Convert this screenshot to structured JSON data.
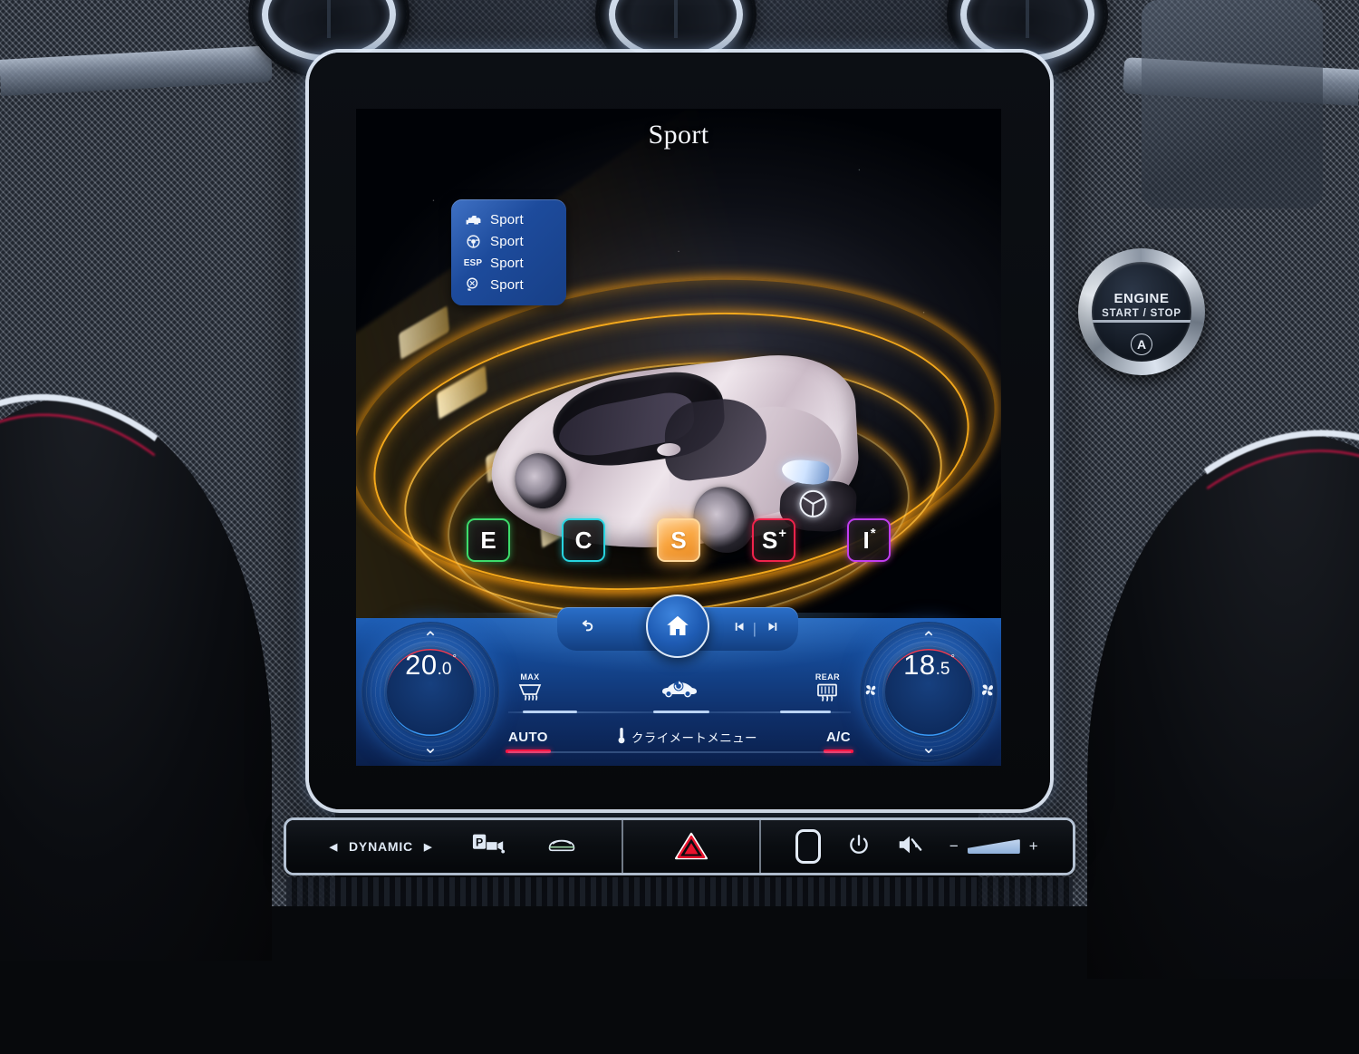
{
  "vehicle_ui": {
    "screen_title": "Sport",
    "mode_list": [
      {
        "icon": "engine-icon",
        "label": "Sport"
      },
      {
        "icon": "steering-wheel-icon",
        "label": "Sport"
      },
      {
        "icon": "esp-icon",
        "label": "Sport",
        "icon_text": "ESP"
      },
      {
        "icon": "suspension-icon",
        "label": "Sport"
      }
    ],
    "drive_modes": [
      {
        "id": "eco",
        "label": "E",
        "sup": "",
        "color": "#3ddc6b",
        "selected": false
      },
      {
        "id": "comfort",
        "label": "C",
        "sup": "",
        "color": "#27d4e0",
        "selected": false
      },
      {
        "id": "sport",
        "label": "S",
        "sup": "",
        "color": "#f9a53f",
        "selected": true
      },
      {
        "id": "sport-plus",
        "label": "S",
        "sup": "+",
        "color": "#f0234b",
        "selected": false
      },
      {
        "id": "individual",
        "label": "I",
        "sup": "*",
        "color": "#c13df0",
        "selected": false
      }
    ],
    "nav_bar": {
      "back_icon": "back-arrow-icon",
      "home_icon": "home-icon",
      "prev_icon": "skip-previous-icon",
      "next_icon": "skip-next-icon",
      "separator": "|"
    },
    "climate": {
      "left_temp": {
        "integer": "20",
        "decimal": ".0",
        "degree": "°"
      },
      "right_temp": {
        "integer": "18",
        "decimal": ".5",
        "degree": "°"
      },
      "up_chevron": "⌃",
      "down_chevron": "⌄",
      "fan_icon_left": "fan-icon",
      "fan_icon_right": "fan-icon",
      "icons": [
        {
          "id": "max-defrost",
          "tag": "MAX",
          "icon": "windshield-defrost-icon"
        },
        {
          "id": "recirculate",
          "tag": "",
          "icon": "air-recirculation-icon"
        },
        {
          "id": "rear-defrost",
          "tag": "REAR",
          "icon": "rear-defrost-icon"
        }
      ],
      "labels": [
        {
          "id": "auto",
          "text": "AUTO",
          "active": true
        },
        {
          "id": "climate-menu",
          "text": "クライメートメニュー",
          "icon": "thermometer-icon",
          "active": false
        },
        {
          "id": "ac",
          "text": "A/C",
          "active": true
        }
      ],
      "accent_color": "#ff1744"
    }
  },
  "hardkeys": {
    "left_group": [
      {
        "id": "dynamic-select",
        "left_arrow": "◀",
        "text": "DYNAMIC",
        "right_arrow": "▶"
      },
      {
        "id": "parking-camera",
        "icon": "parking-camera-icon"
      },
      {
        "id": "vehicle-view",
        "icon": "vehicle-front-icon"
      }
    ],
    "center_group": [
      {
        "id": "hazard-lights",
        "icon": "hazard-triangle-icon",
        "color": "#e8142e"
      }
    ],
    "right_group": [
      {
        "id": "screen-off",
        "icon": "screen-key-icon"
      },
      {
        "id": "power",
        "icon": "power-icon"
      },
      {
        "id": "mute",
        "icon": "mute-icon"
      },
      {
        "id": "volume-down",
        "text": "−"
      },
      {
        "id": "volume-slider",
        "icon": "volume-wedge-icon"
      },
      {
        "id": "volume-up",
        "text": "+"
      }
    ]
  },
  "start_stop_button": {
    "line1": "ENGINE",
    "line2": "START / STOP",
    "auto_label": "A"
  }
}
